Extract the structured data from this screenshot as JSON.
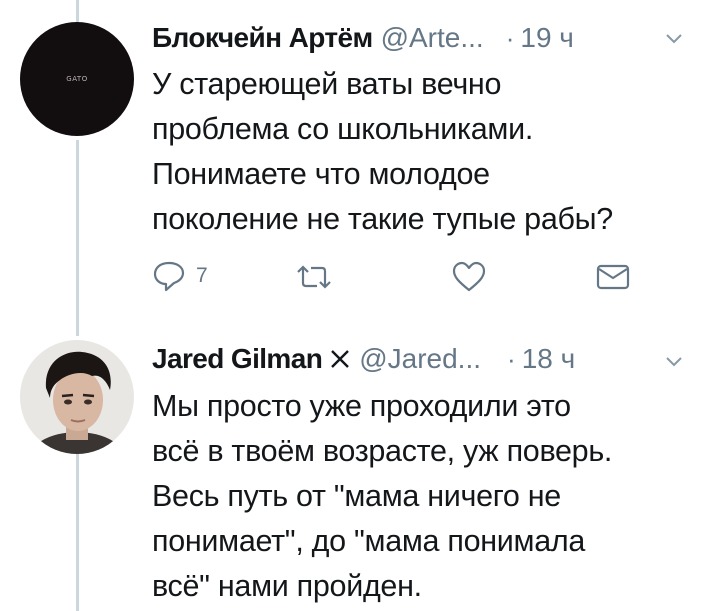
{
  "thread": [
    {
      "author_name": "Блокчейн Артём",
      "handle": "@Arte...",
      "separator": "·",
      "time": "19 ч",
      "avatar_text": "GATO",
      "text_lines": [
        "У стареющей ваты вечно",
        "проблема со школьниками.",
        "Понимаете что молодое",
        "поколение не такие тупые рабы?"
      ],
      "actions": {
        "reply_count": "7",
        "retweet_count": "",
        "like_count": ""
      }
    },
    {
      "author_name": "Jared Gilman",
      "badge_icon": "x-mark-icon",
      "handle": "@Jared...",
      "separator": "·",
      "time": "18 ч",
      "text_lines": [
        "Мы просто уже проходили это",
        "всё в твоём возрасте, уж поверь.",
        "Весь путь от \"мама ничего не",
        "понимает\", до \"мама понимала",
        "всё\" нами пройден."
      ]
    }
  ],
  "colors": {
    "text": "#14171a",
    "muted": "#657786",
    "thread_line": "#ccd6dd",
    "icon": "#657786"
  }
}
